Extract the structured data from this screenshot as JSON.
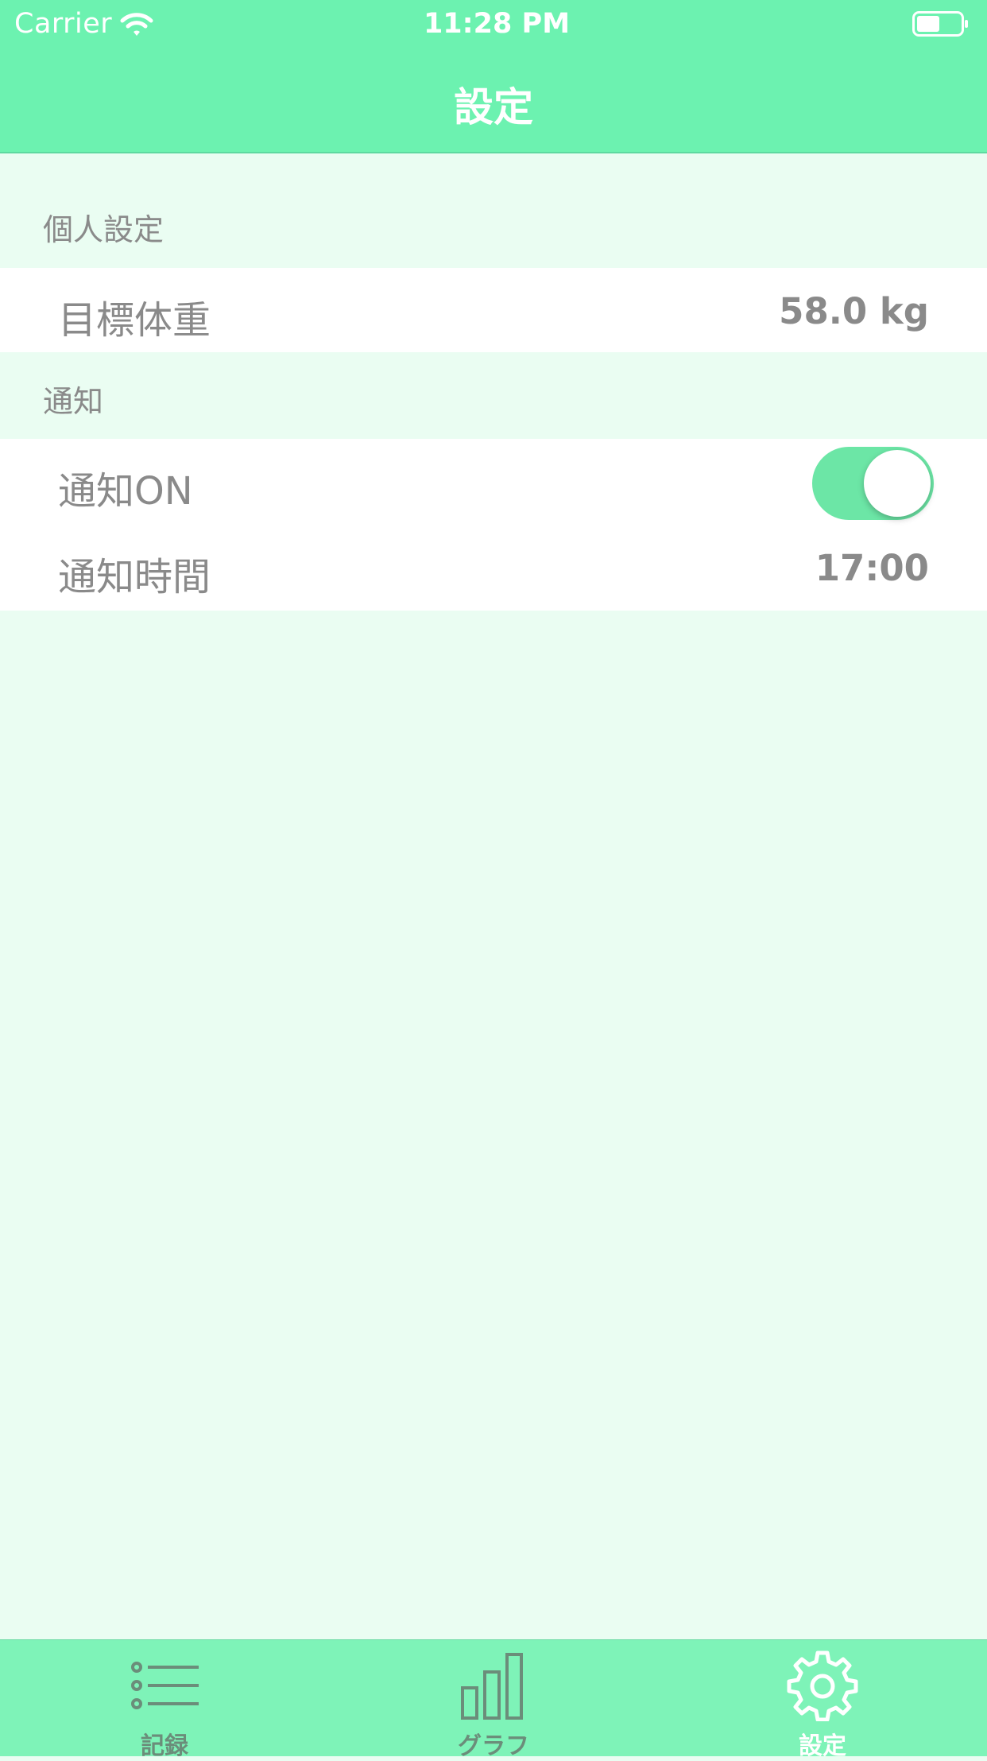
{
  "status_bar": {
    "carrier": "Carrier",
    "time": "11:28 PM"
  },
  "nav": {
    "title": "設定"
  },
  "sections": [
    {
      "header": "個人設定",
      "rows": [
        {
          "label": "目標体重",
          "value": "58.0 kg"
        }
      ]
    },
    {
      "header": "通知",
      "rows": [
        {
          "label": "通知ON",
          "toggle_on": true
        },
        {
          "label": "通知時間",
          "value": "17:00"
        }
      ]
    }
  ],
  "tabs": [
    {
      "label": "記録",
      "icon": "list-icon",
      "selected": false
    },
    {
      "label": "グラフ",
      "icon": "bar-chart-icon",
      "selected": false
    },
    {
      "label": "設定",
      "icon": "gear-icon",
      "selected": true
    }
  ],
  "colors": {
    "accent": "#6cf2b0",
    "background": "#eafdf2",
    "tab_bar": "#7ef3b8",
    "tab_inactive": "#6b8d7a",
    "tab_active": "#ffffff",
    "text": "#8a8a8a",
    "toggle": "#6ce6a6"
  }
}
